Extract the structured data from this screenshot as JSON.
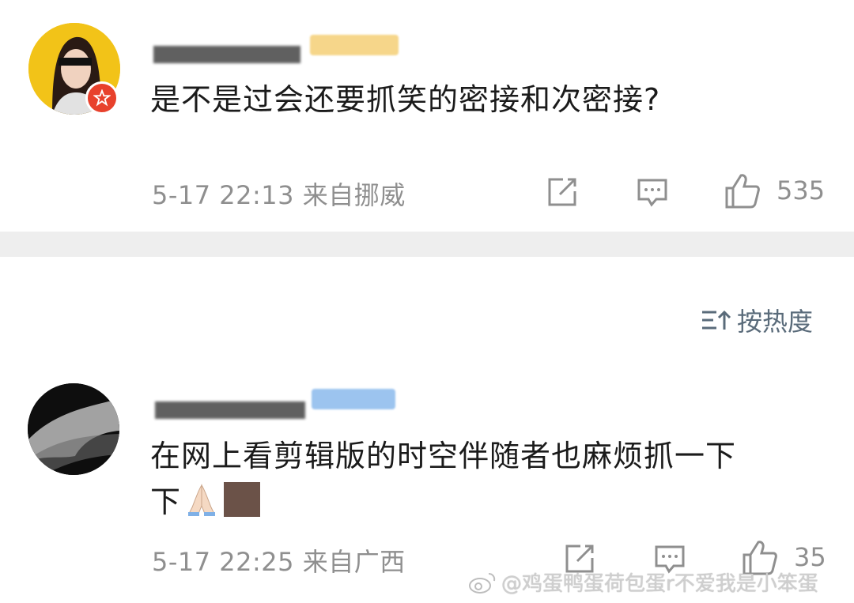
{
  "comments": [
    {
      "text": "是不是过会还要抓笑的密接和次密接?",
      "meta": "5-17 22:13 来自挪威",
      "likes": "535"
    },
    {
      "text": "在网上看剪辑版的时空伴随者也麻烦抓一下",
      "meta": "5-17 22:25 来自广西",
      "likes": "35"
    }
  ],
  "sort_label": "按热度",
  "watermark": "@鸡蛋鸭蛋荷包蛋r不爱我是小笨蛋",
  "icons": [
    "share-icon",
    "comment-icon",
    "like-icon",
    "sort-icon",
    "weibo-logo-icon"
  ],
  "colors": {
    "divider": "#eeeeee",
    "badge": "#e8412c",
    "meta": "#8f8f8f"
  }
}
